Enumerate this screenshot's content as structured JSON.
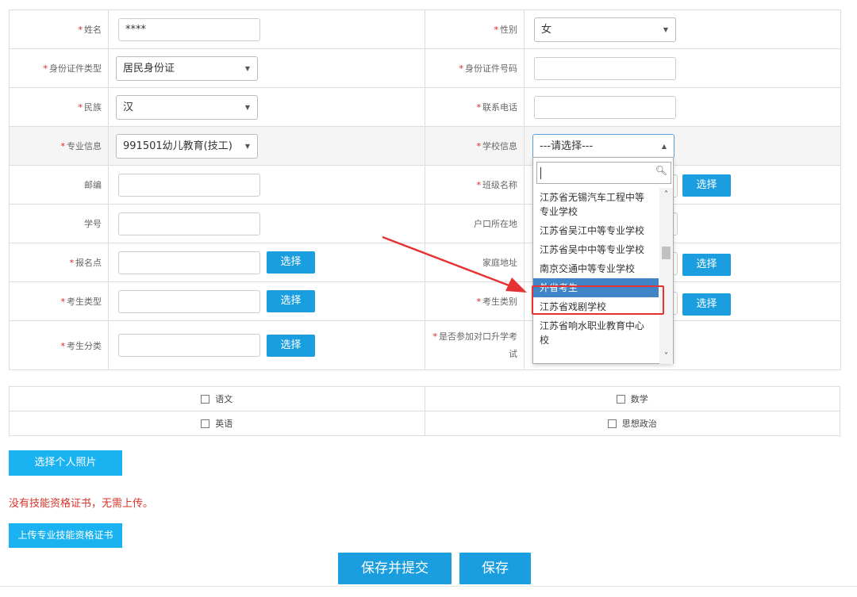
{
  "form": {
    "name_label": "姓名",
    "name_value": "****",
    "gender_label": "性别",
    "gender_value": "女",
    "id_type_label": "身份证件类型",
    "id_type_value": "居民身份证",
    "id_number_label": "身份证件号码",
    "ethnicity_label": "民族",
    "ethnicity_value": "汉",
    "phone_label": "联系电话",
    "major_label": "专业信息",
    "major_value": "991501幼儿教育(技工)",
    "school_label": "学校信息",
    "school_value": "---请选择---",
    "postcode_label": "邮编",
    "class_label": "班级名称",
    "student_no_label": "学号",
    "hukou_label": "户口所在地",
    "signup_point_label": "报名点",
    "home_address_label": "家庭地址",
    "exam_type_label": "考生类型",
    "exam_category_label": "考生类别",
    "exam_class_label": "考生分类",
    "dui_kou_label_line1": "是否参加对口升学考",
    "dui_kou_label_line2": "试",
    "select_label": "选择"
  },
  "dropdown": {
    "search_value": "",
    "items": [
      "江苏省无锡汽车工程中等专业学校",
      "江苏省吴江中等专业学校",
      "江苏省吴中中等专业学校",
      "南京交通中等专业学校",
      "外省考生",
      "江苏省戏剧学校",
      "江苏省响水职业教育中心校"
    ],
    "highlighted": "外省考生"
  },
  "subjects": [
    "语文",
    "数学",
    "英语",
    "思想政治"
  ],
  "photo_button": "选择个人照片",
  "notice": "没有技能资格证书，无需上传。",
  "upload_button": "上传专业技能资格证书",
  "submit_button": "保存并提交",
  "save_button": "保存",
  "colors": {
    "primary": "#1a9ee0",
    "required": "#e02020",
    "highlight": "#3f85c8",
    "annotation": "#e53333"
  }
}
